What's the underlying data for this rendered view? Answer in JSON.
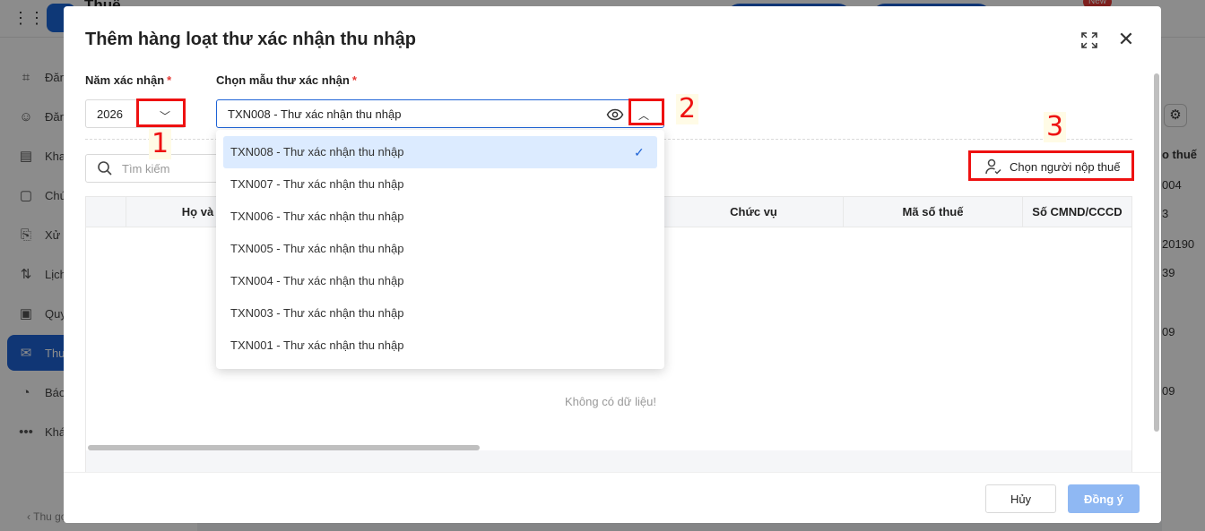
{
  "background": {
    "app_title": "Thuế",
    "badge": "New",
    "sidebar_items": [
      "Đăn",
      "Đăn",
      "Kha",
      "Chú",
      "Xử l",
      "Lịch",
      "Quy",
      "Thư",
      "Báo",
      "Khá"
    ],
    "collapse_label": "Thu gọn",
    "right_col": [
      "o thuế",
      "004",
      "3",
      "20190",
      "39",
      "09",
      "09"
    ]
  },
  "modal": {
    "title": "Thêm hàng loạt thư xác nhận thu nhập",
    "year_label": "Năm xác nhận",
    "template_label": "Chọn mẫu thư xác nhận",
    "required_mark": "*",
    "year_value": "2026",
    "template_value": "TXN008 - Thư xác nhận thu nhập",
    "search_placeholder": "Tìm kiếm",
    "choose_taxpayer_label": "Chọn người nộp thuế",
    "columns": [
      "Họ và",
      "Chức vụ",
      "Mã số thuế",
      "Số CMND/CCCD"
    ],
    "empty_text": "Không có dữ liệu!",
    "cancel_label": "Hủy",
    "ok_label": "Đồng ý"
  },
  "dropdown": {
    "options": [
      "TXN008 - Thư xác nhận thu nhập",
      "TXN007 - Thư xác nhận thu nhập",
      "TXN006 - Thư xác nhận thu nhập",
      "TXN005 - Thư xác nhận thu nhập",
      "TXN004 - Thư xác nhận thu nhập",
      "TXN003 - Thư xác nhận thu nhập",
      "TXN001 - Thư xác nhận thu nhập"
    ],
    "selected_index": 0
  },
  "annotations": [
    "1",
    "2",
    "3"
  ],
  "colors": {
    "primary": "#1e63d6",
    "annotation": "#ee1111",
    "selected_bg": "#dcebff"
  }
}
